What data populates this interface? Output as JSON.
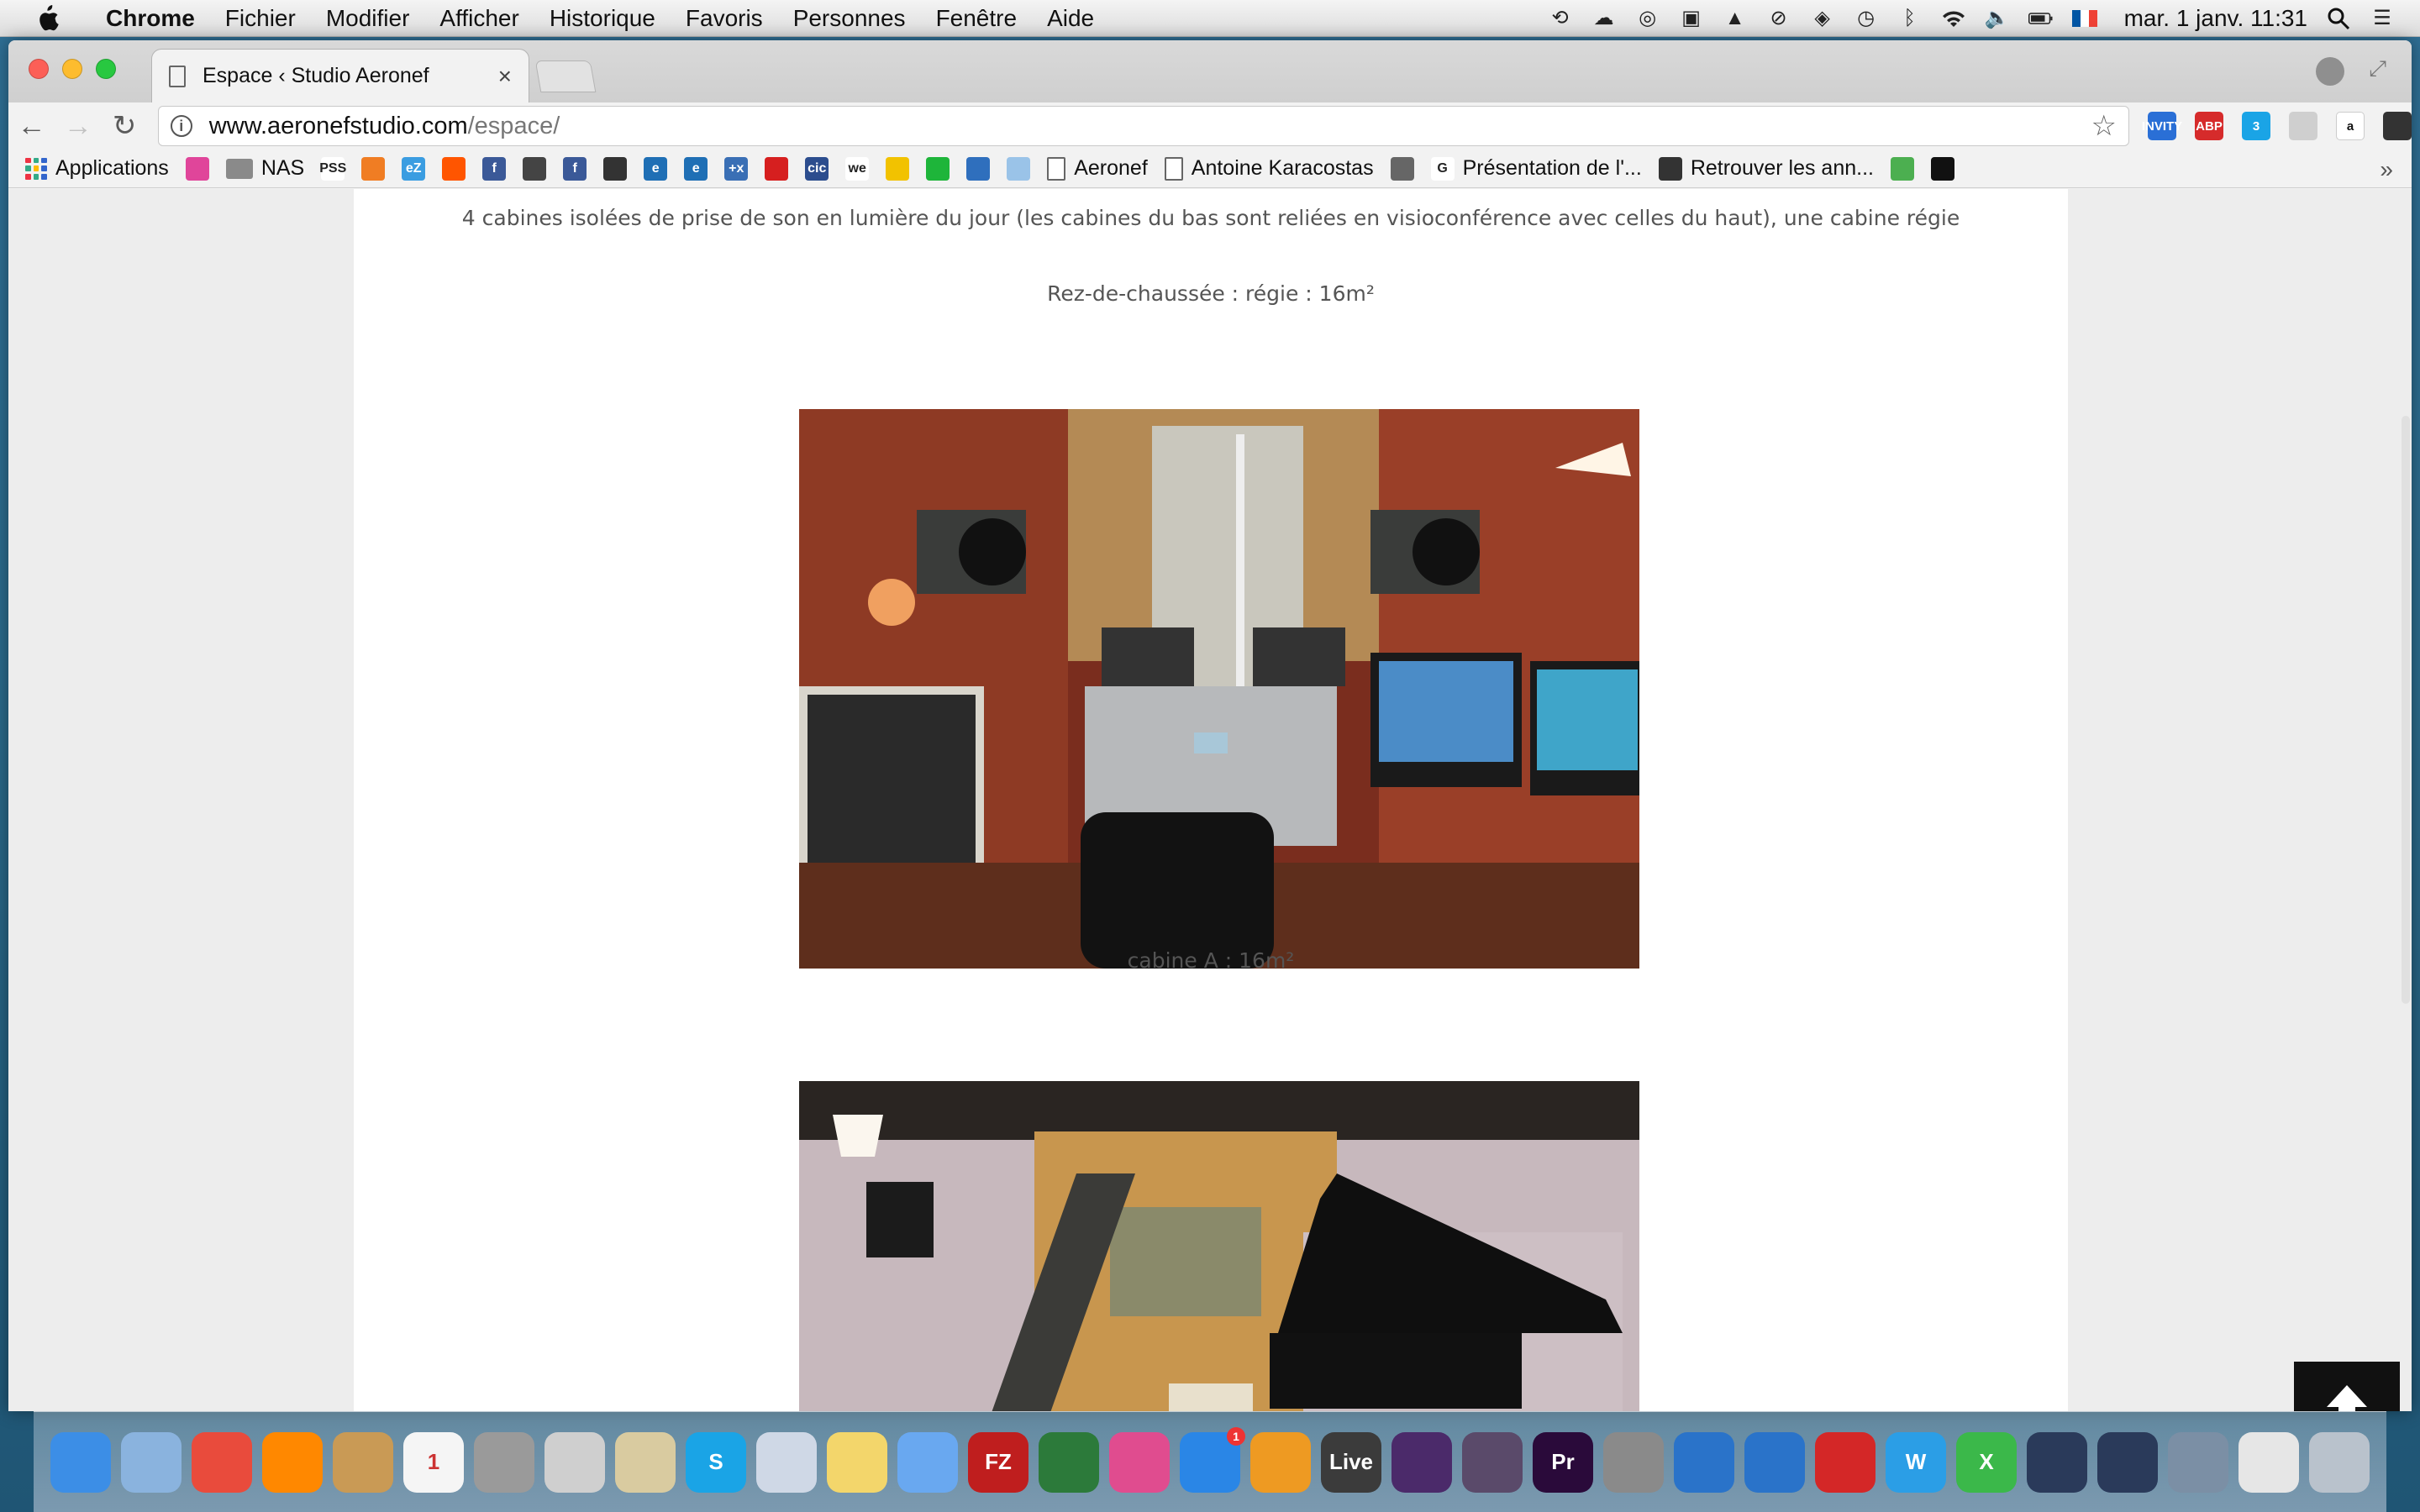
{
  "menubar": {
    "app_name": "Chrome",
    "items": [
      "Fichier",
      "Modifier",
      "Afficher",
      "Historique",
      "Favoris",
      "Personnes",
      "Fenêtre",
      "Aide"
    ],
    "clock": "mar. 1 janv.  11:31",
    "flag_colors": [
      "#0055a4",
      "#ffffff",
      "#ef4135"
    ]
  },
  "browser": {
    "tab_title": "Espace ‹ Studio Aeronef",
    "url_host": "www.aeronefstudio.com",
    "url_path": "/espace/",
    "extensions": [
      {
        "icon": "invity-icon",
        "label": "INVITY",
        "color": "#2a6fd6"
      },
      {
        "icon": "adblock-plus-icon",
        "label": "ABP",
        "color": "#d62b2b"
      },
      {
        "icon": "skype-icon",
        "label": "3",
        "color": "#1aa4e6"
      },
      {
        "icon": "tab-icon",
        "label": "",
        "color": "#cfcfcf"
      },
      {
        "icon": "amazon-icon",
        "label": "a",
        "color": "#ffffff"
      },
      {
        "icon": "mask-icon",
        "label": "",
        "color": "#333333"
      }
    ]
  },
  "bookmarks": [
    {
      "label": "Applications",
      "icon": "apps-grid-icon"
    },
    {
      "label": "",
      "icon": "music-note-icon",
      "color": "#e0459a"
    },
    {
      "label": "NAS",
      "icon": "folder-icon"
    },
    {
      "label": "",
      "icon": "pss-icon",
      "text": "PSS",
      "color": "#ffffff"
    },
    {
      "label": "",
      "icon": "box-icon",
      "color": "#f07d23"
    },
    {
      "label": "",
      "icon": "ez-icon",
      "text": "eZ",
      "color": "#3b9de1"
    },
    {
      "label": "",
      "icon": "soundcloud-icon",
      "color": "#ff5500"
    },
    {
      "label": "",
      "icon": "facebook-icon",
      "text": "f",
      "color": "#3b5998"
    },
    {
      "label": "",
      "icon": "paw-icon",
      "color": "#444444"
    },
    {
      "label": "",
      "icon": "facebook-icon",
      "text": "f",
      "color": "#3b5998"
    },
    {
      "label": "",
      "icon": "treble-clef-icon",
      "color": "#333333"
    },
    {
      "label": "",
      "icon": "e-icon",
      "text": "e",
      "color": "#1f6fb5"
    },
    {
      "label": "",
      "icon": "e-icon",
      "text": "e",
      "color": "#1f6fb5"
    },
    {
      "label": "",
      "icon": "plus-x-icon",
      "text": "+x",
      "color": "#3a6fb5"
    },
    {
      "label": "",
      "icon": "red-flag-icon",
      "color": "#d61f1f"
    },
    {
      "label": "",
      "icon": "cic-icon",
      "text": "cic",
      "color": "#2c4d8e"
    },
    {
      "label": "",
      "icon": "we-icon",
      "text": "we",
      "color": "#ffffff"
    },
    {
      "label": "",
      "icon": "badge-icon",
      "color": "#f2c200"
    },
    {
      "label": "",
      "icon": "tanzania-flag-icon",
      "color": "#1eb53a"
    },
    {
      "label": "",
      "icon": "triangle-icon",
      "color": "#2f6fbd"
    },
    {
      "label": "",
      "icon": "tumblr-icon",
      "color": "#9ac3e8"
    },
    {
      "label": "Aeronef",
      "icon": "page-icon"
    },
    {
      "label": "Antoine Karacostas",
      "icon": "page-icon"
    },
    {
      "label": "",
      "icon": "portrait-icon",
      "color": "#666666"
    },
    {
      "label": "Présentation de l'...",
      "icon": "google-icon",
      "text": "G",
      "color": "#ffffff"
    },
    {
      "label": "Retrouver les ann...",
      "icon": "circle-logo-icon",
      "color": "#333333"
    },
    {
      "label": "",
      "icon": "maps-icon",
      "color": "#4caf50"
    },
    {
      "label": "",
      "icon": "record-icon",
      "color": "#111111"
    }
  ],
  "page": {
    "intro": "4 cabines isolées de prise de son en lumière du jour (les cabines du bas sont reliées en visioconférence avec celles du haut), une cabine régie",
    "caption_regie": "Rez-de-chaussée : régie : 16m²",
    "caption_cabine_a": "cabine A : 16m²",
    "photo1_alt": "control-room-photo",
    "photo2_alt": "cabine-a-photo"
  },
  "dock": [
    {
      "icon": "finder-icon",
      "color": "#3c8ee6"
    },
    {
      "icon": "mail-icon",
      "color": "#8ab3de"
    },
    {
      "icon": "chrome-icon",
      "color": "#e94b3c"
    },
    {
      "icon": "vlc-icon",
      "color": "#ff8800"
    },
    {
      "icon": "contacts-icon",
      "color": "#c99a55"
    },
    {
      "icon": "calendar-icon",
      "text": "1",
      "color": "#f5f5f5"
    },
    {
      "icon": "calculator-icon",
      "color": "#9a9a9a"
    },
    {
      "icon": "dvd-player-icon",
      "color": "#cfcfcf"
    },
    {
      "icon": "switch-icon",
      "color": "#d9cba0"
    },
    {
      "icon": "skype-icon",
      "text": "S",
      "color": "#1aa4e6"
    },
    {
      "icon": "preview-icon",
      "color": "#cfd8e6"
    },
    {
      "icon": "stickies-icon",
      "color": "#f3d66b"
    },
    {
      "icon": "messages-icon",
      "color": "#69a8f0"
    },
    {
      "icon": "filezilla-icon",
      "text": "FZ",
      "color": "#bf1e1e"
    },
    {
      "icon": "photo-booth-icon",
      "color": "#2c7a3a"
    },
    {
      "icon": "itunes-icon",
      "color": "#e04c8f"
    },
    {
      "icon": "app-store-icon",
      "color": "#2a86e6",
      "badge": "1"
    },
    {
      "icon": "garageband-icon",
      "color": "#ee9a22"
    },
    {
      "icon": "ableton-live-icon",
      "text": "Live",
      "color": "#3b3b3b"
    },
    {
      "icon": "sibelius-icon",
      "color": "#4b2a6a"
    },
    {
      "icon": "app-blocked-icon",
      "color": "#5a4a6a"
    },
    {
      "icon": "premiere-icon",
      "text": "Pr",
      "color": "#2a0a3a"
    },
    {
      "icon": "system-preferences-icon",
      "color": "#8a8a8a"
    },
    {
      "icon": "bird-icon",
      "color": "#2a73c9"
    },
    {
      "icon": "frog-icon",
      "color": "#2a73c9"
    },
    {
      "icon": "acrobat-icon",
      "color": "#d42727"
    },
    {
      "icon": "word-icon",
      "text": "W",
      "color": "#2b9ee6"
    },
    {
      "icon": "excel-icon",
      "text": "X",
      "color": "#3bb84a"
    },
    {
      "icon": "uad-meter-icon",
      "color": "#2a3a5a"
    },
    {
      "icon": "uad-console-icon",
      "color": "#2a3a5a"
    },
    {
      "icon": "image-capture-icon",
      "color": "#7b8fa5"
    },
    {
      "icon": "documents-icon",
      "color": "#e6e6e6"
    },
    {
      "icon": "trash-icon",
      "color": "#b9c2cc"
    }
  ]
}
